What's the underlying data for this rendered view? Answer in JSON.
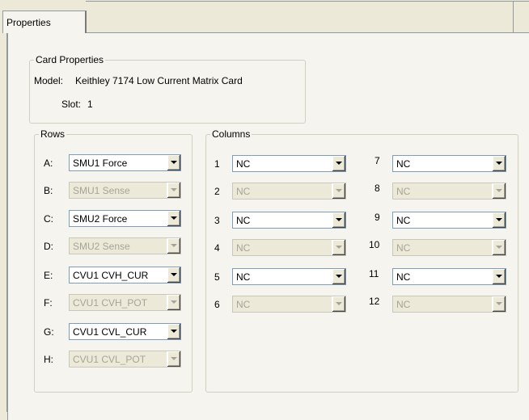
{
  "tabs": [
    "Properties"
  ],
  "card_properties": {
    "title": "Card Properties",
    "model_label": "Model:",
    "model_value": "Keithley 7174 Low Current Matrix Card",
    "slot_label": "Slot:",
    "slot_value": "1"
  },
  "rows": {
    "title": "Rows",
    "items": [
      {
        "label": "A:",
        "value": "SMU1 Force"
      },
      {
        "label": "B:",
        "value": "SMU1 Sense"
      },
      {
        "label": "C:",
        "value": "SMU2 Force"
      },
      {
        "label": "D:",
        "value": "SMU2 Sense"
      },
      {
        "label": "E:",
        "value": "CVU1 CVH_CUR"
      },
      {
        "label": "F:",
        "value": "CVU1 CVH_POT"
      },
      {
        "label": "G:",
        "value": "CVU1 CVL_CUR"
      },
      {
        "label": "H:",
        "value": "CVU1 CVL_POT"
      }
    ]
  },
  "columns": {
    "title": "Columns",
    "items": [
      {
        "label": "1",
        "value": "NC"
      },
      {
        "label": "2",
        "value": "NC"
      },
      {
        "label": "3",
        "value": "NC"
      },
      {
        "label": "4",
        "value": "NC"
      },
      {
        "label": "5",
        "value": "NC"
      },
      {
        "label": "6",
        "value": "NC"
      },
      {
        "label": "7",
        "value": "NC"
      },
      {
        "label": "8",
        "value": "NC"
      },
      {
        "label": "9",
        "value": "NC"
      },
      {
        "label": "10",
        "value": "NC"
      },
      {
        "label": "11",
        "value": "NC"
      },
      {
        "label": "12",
        "value": "NC"
      }
    ]
  },
  "colors": {
    "dialog_bg": "#ece9d8",
    "panel_bg": "#f5f4ee",
    "combo_border": "#7f9db9",
    "disabled_text": "#a5a497"
  }
}
